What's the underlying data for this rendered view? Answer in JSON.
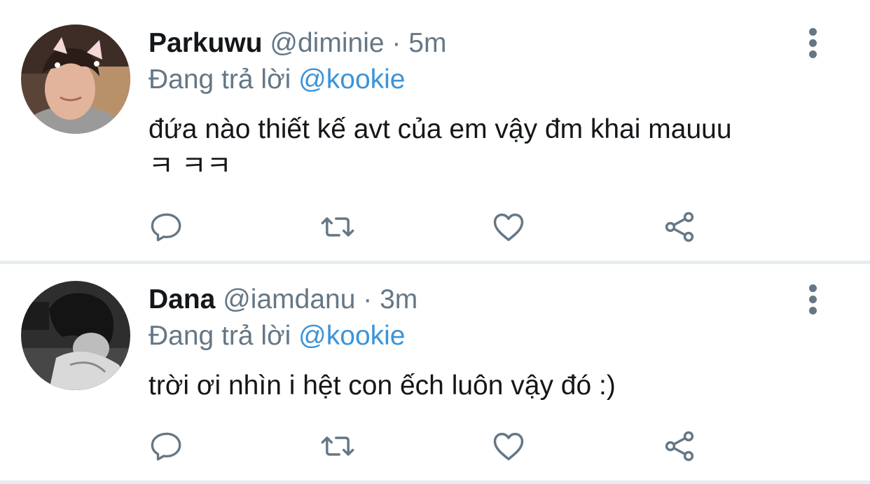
{
  "tweets": [
    {
      "display_name": "Parkuwu",
      "handle": "@diminie",
      "separator": "·",
      "time": "5m",
      "reply_prefix": "Đang trả lời",
      "reply_to": "@kookie",
      "text_line_1": "đứa nào thiết kế avt của em vậy đm khai mauuu",
      "text_line_2": "ㅋ ㅋㅋ",
      "avatar_icon": "avatar-photo",
      "more_icon": "more-vertical-icon"
    },
    {
      "display_name": "Dana",
      "handle": "@iamdanu",
      "separator": "·",
      "time": "3m",
      "reply_prefix": "Đang trả lời",
      "reply_to": "@kookie",
      "text_line_1": "trời ơi nhìn i hệt con ếch luôn vậy đó :)",
      "avatar_icon": "avatar-photo-grayscale",
      "more_icon": "more-vertical-icon"
    }
  ],
  "action_icons": [
    "reply-icon",
    "retweet-icon",
    "like-icon",
    "share-icon"
  ],
  "colors": {
    "text": "#14171a",
    "muted": "#657786",
    "mention": "#3b94d9",
    "divider": "#e6ecf0"
  }
}
